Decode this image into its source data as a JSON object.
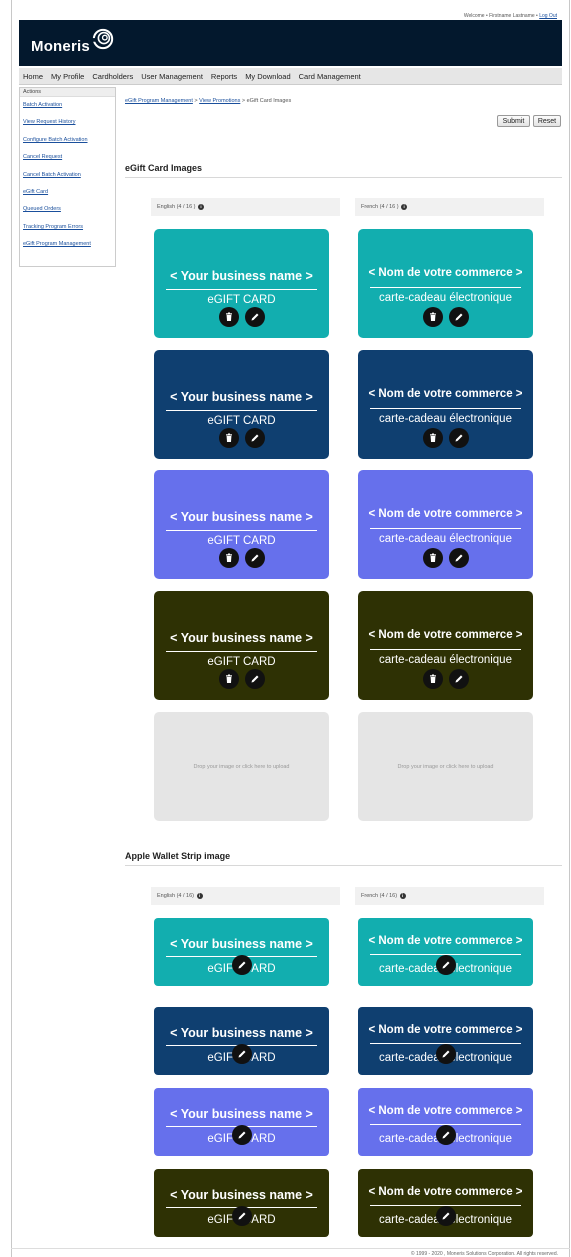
{
  "topbar": {
    "welcome": "Welcome • Firstname Lastname • ",
    "logout": "Log Out"
  },
  "brand": {
    "name": "Moneris"
  },
  "nav": {
    "items": [
      "Home",
      "My Profile",
      "Cardholders",
      "User Management",
      "Reports",
      "My Download",
      "Card Management"
    ]
  },
  "sidebar": {
    "title": "Actions",
    "items": [
      "Batch Activation",
      "View Request History",
      "Configure Batch Activation",
      "Cancel Request",
      "Cancel Batch Activation",
      "eGift Card",
      "Queued Orders",
      "Tracking Program Errors",
      "eGift Program Management"
    ]
  },
  "breadcrumb": {
    "link1": "eGift Program Management",
    "sep1": " > ",
    "link2": "View Promotions",
    "sep2": " > ",
    "current": "eGift Card Images"
  },
  "buttons": {
    "submit": "Submit",
    "reset": "Reset"
  },
  "gift_section": {
    "title": "eGift Card Images",
    "english_header": "English (4 / 16 )",
    "french_header": "French (4 / 16 )",
    "english_name": "< Your business name >",
    "english_sub": "eGIFT CARD",
    "french_name": "< Nom de votre commerce >",
    "french_sub": "carte-cadeau électronique",
    "dropzone_text": "Drop your image or click here to upload"
  },
  "wallet_section": {
    "title": "Apple Wallet Strip image",
    "english_header": "English (4 / 16)",
    "french_header": "French (4 / 16)"
  },
  "card_colors": [
    "#12aeaf",
    "#0f3f70",
    "#6670ec",
    "#2e3104"
  ],
  "icons": {
    "info": "info-icon",
    "delete": "trash-icon",
    "edit": "pencil-icon"
  },
  "footer": {
    "copyright": "© 1999 - 2020 , Moneris Solutions Corporation. All rights reserved."
  }
}
